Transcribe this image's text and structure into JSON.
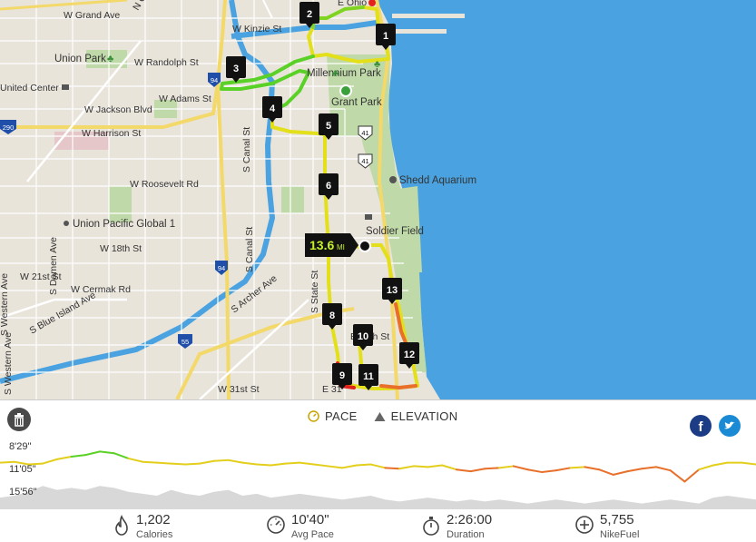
{
  "map": {
    "labels": {
      "w_grand": "W Grand Ave",
      "w_kinzie": "W Kinzie St",
      "union_park": "Union Park",
      "w_randolph": "W Randolph St",
      "united_center": "United Center",
      "w_adams": "W Adams St",
      "w_jackson": "W Jackson Blvd",
      "w_harrison": "W Harrison St",
      "w_roosevelt": "W Roosevelt Rd",
      "union_pacific": "Union Pacific Global 1",
      "w_18th": "W 18th St",
      "w_21st": "W 21st St",
      "w_cermak": "W Cermak Rd",
      "s_blue_island": "S Blue Island Ave",
      "s_western": "S Western Ave",
      "s_damen": "S Damen Ave",
      "s_canal": "S Canal St",
      "s_archer": "S Archer Ave",
      "s_state": "S State St",
      "w_31st": "W 31st St",
      "grant_park": "Grant Park",
      "millennium_park": "Millennium Park",
      "shedd": "Shedd Aquarium",
      "soldier_field": "Soldier Field",
      "e_ohio": "E Ohio",
      "e_26th": "E 26th St",
      "e_31st": "E 31",
      "hwy_41": "41",
      "hwy_94": "94",
      "hwy_290": "290",
      "hwy_55": "55",
      "s_ogden": "N Ogden Ave"
    },
    "distance_badge": {
      "value": "13.6",
      "unit": "MI"
    },
    "markers": [
      "1",
      "2",
      "3",
      "4",
      "5",
      "6",
      "8",
      "9",
      "10",
      "11",
      "12",
      "13"
    ],
    "colors": {
      "water": "#4aa3e0",
      "land": "#e9e4da",
      "park": "#bfd9a8",
      "route_fast": "#5ad126",
      "route_mid": "#e3e01b",
      "route_slow": "#e3221b"
    }
  },
  "panel": {
    "legend": {
      "pace": "PACE",
      "elevation": "ELEVATION"
    },
    "y_labels": [
      "8'29\"",
      "11'05\"",
      "15'56\""
    ],
    "stats": [
      {
        "icon": "flame-icon",
        "value": "1,202",
        "label": "Calories"
      },
      {
        "icon": "speedometer-icon",
        "value": "10'40\"",
        "label": "Avg Pace"
      },
      {
        "icon": "stopwatch-icon",
        "value": "2:26:00",
        "label": "Duration"
      },
      {
        "icon": "plus-circle-icon",
        "value": "5,755",
        "label": "NikeFuel"
      }
    ],
    "social": {
      "facebook": "f",
      "twitter": "twitter"
    }
  },
  "chart_data": {
    "type": "line",
    "title": "",
    "ylabel": "",
    "y_ticks": [
      "8'29\"",
      "11'05\"",
      "15'56\""
    ],
    "series": [
      {
        "name": "PACE",
        "values": [
          11.0,
          10.9,
          11.2,
          11.1,
          10.6,
          10.3,
          10.1,
          9.7,
          9.9,
          10.5,
          10.9,
          11.0,
          11.1,
          11.2,
          11.1,
          10.8,
          10.7,
          11.0,
          11.2,
          11.3,
          11.1,
          11.0,
          11.2,
          11.4,
          11.6,
          11.3,
          11.2,
          11.6,
          11.7,
          11.4,
          11.5,
          11.3,
          11.8,
          12.0,
          11.7,
          11.6,
          11.4,
          11.8,
          12.1,
          11.9,
          11.6,
          11.5,
          11.8,
          12.4,
          12.0,
          11.7,
          11.5,
          11.9,
          13.2,
          11.8,
          11.3,
          11.0,
          11.0,
          11.2
        ]
      },
      {
        "name": "ELEVATION",
        "values": [
          6,
          7,
          9,
          12,
          10,
          11,
          10,
          12,
          11,
          9,
          8,
          7,
          10,
          8,
          7,
          9,
          10,
          7,
          8,
          6,
          7,
          8,
          7,
          6,
          5,
          6,
          7,
          5,
          4,
          5,
          6,
          5,
          4,
          5,
          4,
          5,
          4,
          3,
          4,
          5,
          4,
          3,
          4,
          5,
          4,
          3,
          4,
          5,
          4,
          3,
          6,
          7,
          6,
          5
        ]
      }
    ]
  }
}
